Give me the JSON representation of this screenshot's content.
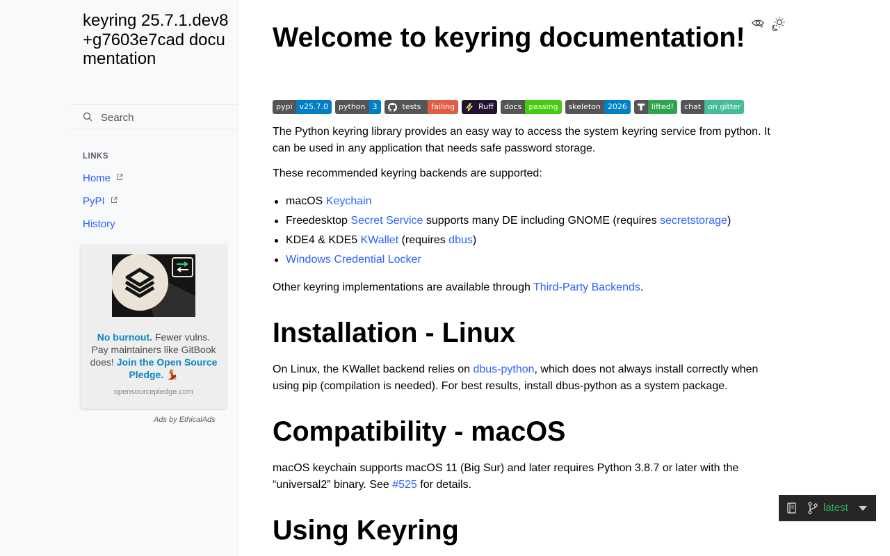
{
  "sidebar": {
    "brand": "keyring 25.7.1.dev8+g7603e7cad documentation",
    "search_placeholder": "Search",
    "caption": "LINKS",
    "items": [
      {
        "label": "Home",
        "external": true
      },
      {
        "label": "PyPI",
        "external": true
      },
      {
        "label": "History",
        "external": false
      }
    ],
    "ad": {
      "bold_lead": "No burnout.",
      "text_mid": " Fewer vulns. Pay maintainers like GitBook does! ",
      "bold_link": "Join the Open Source Pledge.",
      "emoji": "💃",
      "domain": "opensourcepledge.com",
      "by": "Ads by EthicalAds"
    }
  },
  "main": {
    "title": "Welcome to keyring documentation!",
    "badges": [
      {
        "left": "pypi",
        "right": "v25.7.0",
        "color": "#007ec6"
      },
      {
        "left": "python",
        "right": "3",
        "color": "#007ec6"
      },
      {
        "left": "tests",
        "right": "failing",
        "color": "#e05d44",
        "icon": "github-icon"
      },
      {
        "left": "",
        "right": "Ruff",
        "color": "#261230",
        "left_color": "#261230",
        "icon": "ruff-icon"
      },
      {
        "left": "docs",
        "right": "passing",
        "color": "#4c1"
      },
      {
        "left": "skeleton",
        "right": "2026",
        "color": "#007ec6"
      },
      {
        "left": "",
        "right": "lifted!",
        "color": "#2ea44f",
        "icon": "tidelift-icon"
      },
      {
        "left": "chat",
        "right": "on gitter",
        "color": "#46bc99"
      }
    ],
    "intro": "The Python keyring library provides an easy way to access the system keyring service from python. It can be used in any application that needs safe password storage.",
    "backends_intro": "These recommended keyring backends are supported:",
    "backends": {
      "b1_pre": "macOS ",
      "b1_link": "Keychain",
      "b2_pre": "Freedesktop ",
      "b2_link": "Secret Service",
      "b2_mid": " supports many DE including GNOME (requires ",
      "b2_link2": "secretstorage",
      "b2_post": ")",
      "b3_pre": "KDE4 & KDE5 ",
      "b3_link": "KWallet",
      "b3_mid": " (requires ",
      "b3_link2": "dbus",
      "b3_post": ")",
      "b4_link": "Windows Credential Locker"
    },
    "other_pre": "Other keyring implementations are available through ",
    "other_link": "Third-Party Backends",
    "other_post": ".",
    "h_install": "Installation - Linux",
    "install_pre": "On Linux, the KWallet backend relies on ",
    "install_link": "dbus-python",
    "install_post": ", which does not always install correctly when using pip (compilation is needed). For best results, install dbus-python as a system package.",
    "h_compat": "Compatibility - macOS",
    "compat_pre": "macOS keychain supports macOS 11 (Big Sur) and later requires Python 3.8.7 or later with the “universal2” binary. See ",
    "compat_link": "#525",
    "compat_post": " for details.",
    "h_using": "Using Keyring"
  },
  "rtd": {
    "version": "latest"
  }
}
